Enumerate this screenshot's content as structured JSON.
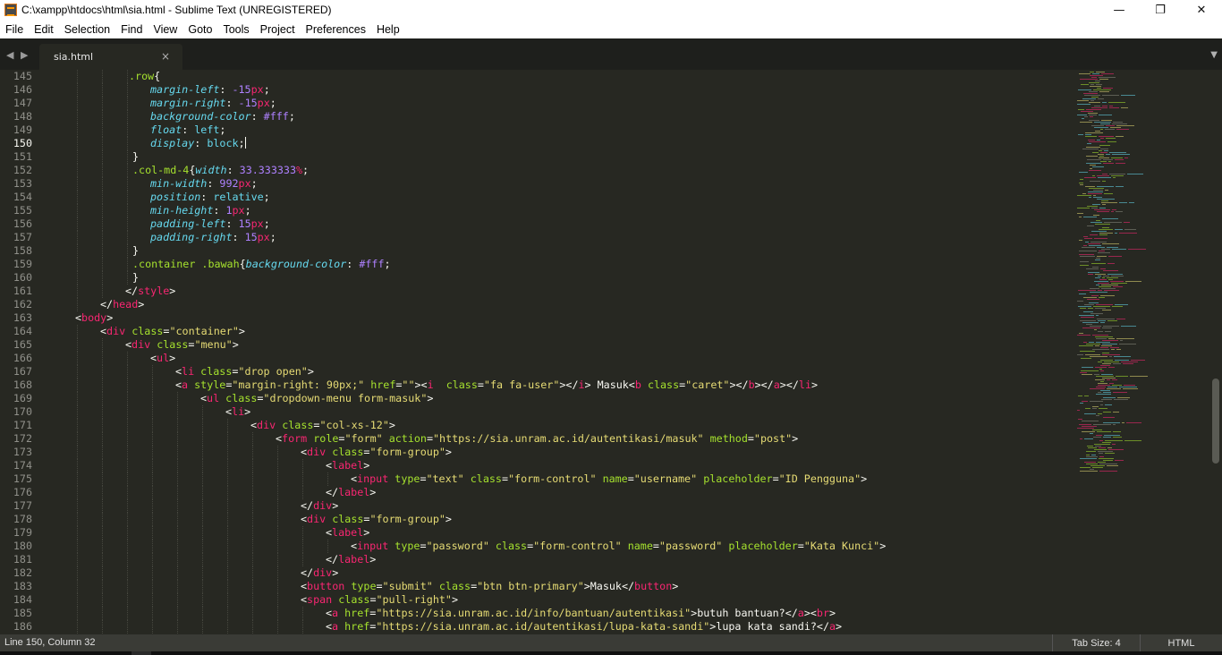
{
  "window": {
    "title": "C:\\xampp\\htdocs\\html\\sia.html - Sublime Text (UNREGISTERED)",
    "minimize_glyph": "—",
    "maximize_glyph": "❐",
    "close_glyph": "✕"
  },
  "menu": [
    "File",
    "Edit",
    "Selection",
    "Find",
    "View",
    "Goto",
    "Tools",
    "Project",
    "Preferences",
    "Help"
  ],
  "tabs": {
    "back_glyph": "◀",
    "forward_glyph": "▶",
    "active_tab": "sia.html",
    "close_glyph": "×",
    "dropdown_glyph": "▼"
  },
  "editor": {
    "current_line": 150,
    "lines": [
      {
        "n": "145",
        "i": 144,
        "h": "<span class=\"se\">.row</span><span class=\"pl\">{</span>"
      },
      {
        "n": "146",
        "i": 168,
        "h": "<span class=\"pr\">margin-left</span>: <span class=\"nm\">-15</span><span class=\"un\">px</span>;"
      },
      {
        "n": "147",
        "i": 168,
        "h": "<span class=\"pr\">margin-right</span>: <span class=\"nm\">-15</span><span class=\"un\">px</span>;"
      },
      {
        "n": "148",
        "i": 168,
        "h": "<span class=\"pr\">background-color</span>: <span class=\"nm\">#fff</span>;"
      },
      {
        "n": "149",
        "i": 168,
        "h": "<span class=\"pr\">float</span>: <span class=\"pr\" style=\"font-style:normal\">left</span>;"
      },
      {
        "n": "150",
        "i": 168,
        "h": "<span class=\"pr\">display</span>: <span class=\"pr\" style=\"font-style:normal\">block</span>;<span class=\"cursor\"></span>"
      },
      {
        "n": "151",
        "i": 148,
        "h": "}"
      },
      {
        "n": "152",
        "i": 148,
        "h": "<span class=\"se\">.col-md-4</span>{<span class=\"pr\">width</span>: <span class=\"nm\">33.333333</span><span class=\"un\">%</span>;"
      },
      {
        "n": "153",
        "i": 168,
        "h": "<span class=\"pr\">min-width</span>: <span class=\"nm\">992</span><span class=\"un\">px</span>;"
      },
      {
        "n": "154",
        "i": 168,
        "h": "<span class=\"pr\">position</span>: <span class=\"pr\" style=\"font-style:normal\">relative</span>;"
      },
      {
        "n": "155",
        "i": 168,
        "h": "<span class=\"pr\">min-height</span>: <span class=\"nm\">1</span><span class=\"un\">px</span>;"
      },
      {
        "n": "156",
        "i": 168,
        "h": "<span class=\"pr\">padding-left</span>: <span class=\"nm\">15</span><span class=\"un\">px</span>;"
      },
      {
        "n": "157",
        "i": 168,
        "h": "<span class=\"pr\">padding-right</span>: <span class=\"nm\">15</span><span class=\"un\">px</span>;"
      },
      {
        "n": "158",
        "i": 148,
        "h": "}"
      },
      {
        "n": "159",
        "i": 148,
        "h": "<span class=\"se\">.container .bawah</span>{<span class=\"pr\">background-color</span>: <span class=\"nm\">#fff</span>;"
      },
      {
        "n": "160",
        "i": 148,
        "h": "}"
      },
      {
        "n": "161",
        "i": 140,
        "h": "&lt;/<span class=\"tg\">style</span>&gt;"
      },
      {
        "n": "162",
        "i": 112,
        "h": "&lt;/<span class=\"tg\">head</span>&gt;"
      },
      {
        "n": "163",
        "i": 84,
        "h": "&lt;<span class=\"tg\">body</span>&gt;"
      },
      {
        "n": "164",
        "i": 112,
        "h": "&lt;<span class=\"tg\">div</span> <span class=\"at\">class</span>=<span class=\"st\">\"container\"</span>&gt;"
      },
      {
        "n": "165",
        "i": 140,
        "h": "&lt;<span class=\"tg\">div</span> <span class=\"at\">class</span>=<span class=\"st\">\"menu\"</span>&gt;"
      },
      {
        "n": "166",
        "i": 168,
        "h": "&lt;<span class=\"tg\">ul</span>&gt;"
      },
      {
        "n": "167",
        "i": 196,
        "h": "&lt;<span class=\"tg\">li</span> <span class=\"at\">class</span>=<span class=\"st\">\"drop open\"</span>&gt;"
      },
      {
        "n": "168",
        "i": 196,
        "h": "&lt;<span class=\"tg\">a</span> <span class=\"at\">style</span>=<span class=\"st\">\"margin-right: 90px;\"</span> <span class=\"at\">href</span>=<span class=\"st\">\"\"</span>&gt;&lt;<span class=\"tg\">i</span>  <span class=\"at\">class</span>=<span class=\"st\">\"fa fa-user\"</span>&gt;&lt;/<span class=\"tg\">i</span>&gt; Masuk&lt;<span class=\"tg\">b</span> <span class=\"at\">class</span>=<span class=\"st\">\"caret\"</span>&gt;&lt;/<span class=\"tg\">b</span>&gt;&lt;/<span class=\"tg\">a</span>&gt;&lt;/<span class=\"tg\">li</span>&gt;"
      },
      {
        "n": "169",
        "i": 224,
        "h": "&lt;<span class=\"tg\">ul</span> <span class=\"at\">class</span>=<span class=\"st\">\"dropdown-menu form-masuk\"</span>&gt;"
      },
      {
        "n": "170",
        "i": 252,
        "h": "&lt;<span class=\"tg\">li</span>&gt;"
      },
      {
        "n": "171",
        "i": 280,
        "h": "&lt;<span class=\"tg\">div</span> <span class=\"at\">class</span>=<span class=\"st\">\"col-xs-12\"</span>&gt;"
      },
      {
        "n": "172",
        "i": 308,
        "h": "&lt;<span class=\"tg\">form</span> <span class=\"at\">role</span>=<span class=\"st\">\"form\"</span> <span class=\"at\">action</span>=<span class=\"st\">\"https://sia.unram.ac.id/autentikasi/masuk\"</span> <span class=\"at\">method</span>=<span class=\"st\">\"post\"</span>&gt;"
      },
      {
        "n": "173",
        "i": 336,
        "h": "&lt;<span class=\"tg\">div</span> <span class=\"at\">class</span>=<span class=\"st\">\"form-group\"</span>&gt;"
      },
      {
        "n": "174",
        "i": 364,
        "h": "&lt;<span class=\"tg\">label</span>&gt;"
      },
      {
        "n": "175",
        "i": 392,
        "h": "&lt;<span class=\"tg\">input</span> <span class=\"at\">type</span>=<span class=\"st\">\"text\"</span> <span class=\"at\">class</span>=<span class=\"st\">\"form-control\"</span> <span class=\"at\">name</span>=<span class=\"st\">\"username\"</span> <span class=\"at\">placeholder</span>=<span class=\"st\">\"ID Pengguna\"</span>&gt;"
      },
      {
        "n": "176",
        "i": 364,
        "h": "&lt;/<span class=\"tg\">label</span>&gt;"
      },
      {
        "n": "177",
        "i": 336,
        "h": "&lt;/<span class=\"tg\">div</span>&gt;"
      },
      {
        "n": "178",
        "i": 336,
        "h": "&lt;<span class=\"tg\">div</span> <span class=\"at\">class</span>=<span class=\"st\">\"form-group\"</span>&gt;"
      },
      {
        "n": "179",
        "i": 364,
        "h": "&lt;<span class=\"tg\">label</span>&gt;"
      },
      {
        "n": "180",
        "i": 392,
        "h": "&lt;<span class=\"tg\">input</span> <span class=\"at\">type</span>=<span class=\"st\">\"password\"</span> <span class=\"at\">class</span>=<span class=\"st\">\"form-control\"</span> <span class=\"at\">name</span>=<span class=\"st\">\"password\"</span> <span class=\"at\">placeholder</span>=<span class=\"st\">\"Kata Kunci\"</span>&gt;"
      },
      {
        "n": "181",
        "i": 364,
        "h": "&lt;/<span class=\"tg\">label</span>&gt;"
      },
      {
        "n": "182",
        "i": 336,
        "h": "&lt;/<span class=\"tg\">div</span>&gt;"
      },
      {
        "n": "183",
        "i": 336,
        "h": "&lt;<span class=\"tg\">button</span> <span class=\"at\">type</span>=<span class=\"st\">\"submit\"</span> <span class=\"at\">class</span>=<span class=\"st\">\"btn btn-primary\"</span>&gt;Masuk&lt;/<span class=\"tg\">button</span>&gt;"
      },
      {
        "n": "184",
        "i": 336,
        "h": "&lt;<span class=\"tg\">span</span> <span class=\"at\">class</span>=<span class=\"st\">\"pull-right\"</span>&gt;"
      },
      {
        "n": "185",
        "i": 364,
        "h": "&lt;<span class=\"tg\">a</span> <span class=\"at\">href</span>=<span class=\"st\">\"https://sia.unram.ac.id/info/bantuan/autentikasi\"</span>&gt;butuh bantuan?&lt;/<span class=\"tg\">a</span>&gt;&lt;<span class=\"tg\">br</span>&gt;"
      },
      {
        "n": "186",
        "i": 364,
        "h": "&lt;<span class=\"tg\">a</span> <span class=\"at\">href</span>=<span class=\"st\">\"https://sia.unram.ac.id/autentikasi/lupa-kata-sandi\"</span>&gt;lupa kata sandi?&lt;/<span class=\"tg\">a</span>&gt;"
      }
    ]
  },
  "status": {
    "position": "Line 150, Column 32",
    "tab_size": "Tab Size: 4",
    "syntax": "HTML"
  },
  "colors": {
    "background": "#272822",
    "tag": "#f92672",
    "attribute": "#a6e22e",
    "string": "#e6db74",
    "property": "#66d9ef",
    "number": "#ae81ff"
  }
}
